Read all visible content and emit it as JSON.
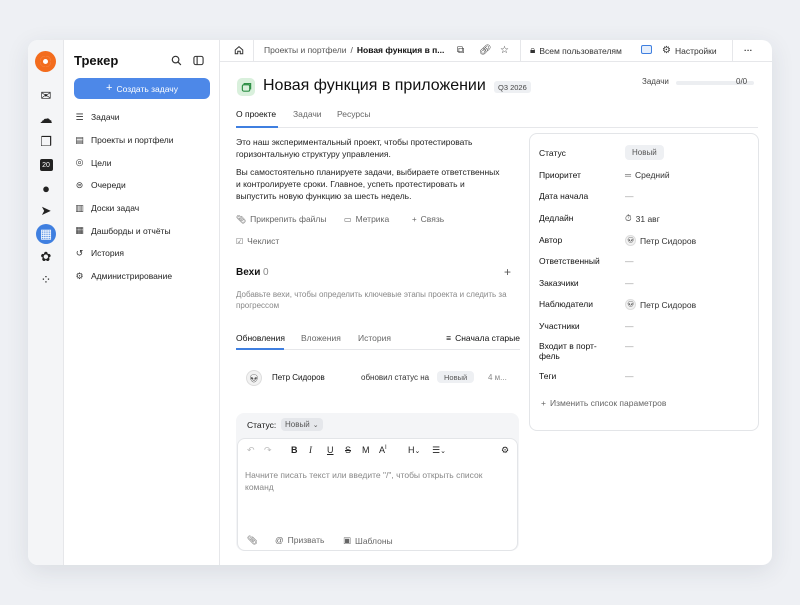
{
  "sidebar": {
    "title": "Трекер",
    "create_button": "Создать задачу",
    "items": [
      {
        "label": "Задачи",
        "icon": "list-icon"
      },
      {
        "label": "Проекты и портфели",
        "icon": "folder-icon"
      },
      {
        "label": "Цели",
        "icon": "target-icon"
      },
      {
        "label": "Очереди",
        "icon": "queue-icon"
      },
      {
        "label": "Доски задач",
        "icon": "board-icon"
      },
      {
        "label": "Дашборды и отчёты",
        "icon": "dashboard-icon"
      },
      {
        "label": "История",
        "icon": "history-icon"
      },
      {
        "label": "Администрирование",
        "icon": "wrench-icon"
      }
    ]
  },
  "rail": {
    "icons": [
      "mail-icon",
      "disk-icon",
      "docs-icon",
      "calendar-icon",
      "messenger-icon",
      "send-icon",
      "tracker-icon",
      "paw-icon",
      "apps-icon"
    ],
    "calendar_day": "20"
  },
  "topbar": {
    "breadcrumb_parent": "Проекты и портфели",
    "breadcrumb_separator": "/",
    "breadcrumb_current": "Новая функция в п...",
    "access": "Всем пользователям",
    "settings": "Настройки",
    "more": "···"
  },
  "project": {
    "title": "Новая функция в приложении",
    "quarter": "Q3 2026",
    "tasks_label": "Задачи",
    "tasks_count": "0/0",
    "tasks_progress": 0
  },
  "tabs": [
    "О проекте",
    "Задачи",
    "Ресурсы"
  ],
  "description": [
    "Это наш экспериментальный проект, чтобы протестировать горизонтальную структуру управления.",
    "Вы самостоятельно планируете задачи, выбираете ответственных и контролируете сроки. Главное, успеть протестировать и выпустить новую функцию за шесть недель."
  ],
  "actions": {
    "attach": "Прикрепить файлы",
    "metric": "Метрика",
    "link": "Связь",
    "checklist": "Чеклист"
  },
  "milestones": {
    "title": "Вехи",
    "count": "0",
    "hint": "Добавьте вехи, чтобы определить ключевые этапы проекта и следить за прогрессом"
  },
  "subtabs": {
    "items": [
      "Обновления",
      "Вложения",
      "История"
    ],
    "sort": "Сначала старые"
  },
  "activity": {
    "author": "Петр Сидоров",
    "text": "обновил статус на",
    "status": "Новый",
    "time": "4 м..."
  },
  "editor": {
    "status_label": "Статус:",
    "status_value": "Новый",
    "placeholder": "Начните писать текст или введите \"/\", чтобы открыть список команд",
    "call": "Призвать",
    "templates": "Шаблоны"
  },
  "properties": [
    {
      "label": "Статус",
      "value": "Новый",
      "kind": "pill"
    },
    {
      "label": "Приоритет",
      "value": "Средний",
      "kind": "priority"
    },
    {
      "label": "Дата начала",
      "value": "—",
      "kind": "dash"
    },
    {
      "label": "Дедлайн",
      "value": "31 авг",
      "kind": "deadline"
    },
    {
      "label": "Автор",
      "value": "Петр Сидоров",
      "kind": "user"
    },
    {
      "label": "Ответственный",
      "value": "—",
      "kind": "dash"
    },
    {
      "label": "Заказчики",
      "value": "—",
      "kind": "dash"
    },
    {
      "label": "Наблюдатели",
      "value": "Петр Сидоров",
      "kind": "user"
    },
    {
      "label": "Участники",
      "value": "—",
      "kind": "dash"
    },
    {
      "label": "Входит в порт-фель",
      "value": "—",
      "kind": "dash"
    },
    {
      "label": "Теги",
      "value": "—",
      "kind": "dash"
    }
  ],
  "edit_params": "Изменить список параметров",
  "colors": {
    "accent": "#4d88e8",
    "brand": "#f36c1d",
    "project_icon_bg": "#d9f0dc"
  }
}
